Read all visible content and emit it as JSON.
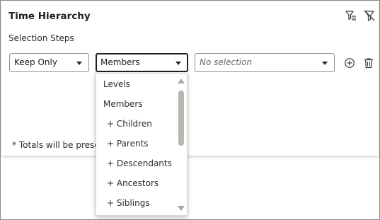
{
  "header": {
    "title": "Time Hierarchy",
    "subtitle": "Selection Steps"
  },
  "step": {
    "action_select": "Keep Only",
    "type_select": "Members",
    "value_select_placeholder": "No selection"
  },
  "footnote": "* Totals will be preser",
  "dropdown": {
    "options": [
      "Levels",
      "Members",
      "+ Children",
      "+ Parents",
      "+ Descendants",
      "+ Ancestors",
      "+ Siblings"
    ]
  },
  "icons": {
    "filter_toggle": "filter-list-icon",
    "clear_filter": "clear-filter-icon",
    "add": "add-circle-icon",
    "delete": "trash-icon"
  }
}
